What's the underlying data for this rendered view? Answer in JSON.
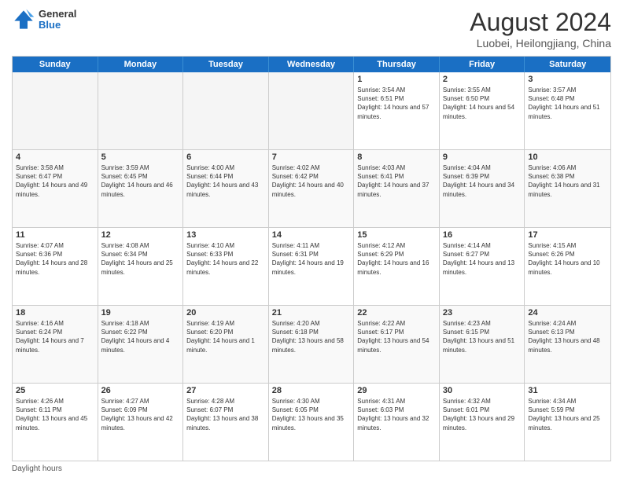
{
  "header": {
    "logo_general": "General",
    "logo_blue": "Blue",
    "main_title": "August 2024",
    "subtitle": "Luobei, Heilongjiang, China"
  },
  "footer": {
    "daylight_label": "Daylight hours"
  },
  "weekdays": [
    "Sunday",
    "Monday",
    "Tuesday",
    "Wednesday",
    "Thursday",
    "Friday",
    "Saturday"
  ],
  "weeks": [
    {
      "cells": [
        {
          "day": "",
          "info": "",
          "empty": true
        },
        {
          "day": "",
          "info": "",
          "empty": true
        },
        {
          "day": "",
          "info": "",
          "empty": true
        },
        {
          "day": "",
          "info": "",
          "empty": true
        },
        {
          "day": "1",
          "info": "Sunrise: 3:54 AM\nSunset: 6:51 PM\nDaylight: 14 hours and 57 minutes."
        },
        {
          "day": "2",
          "info": "Sunrise: 3:55 AM\nSunset: 6:50 PM\nDaylight: 14 hours and 54 minutes."
        },
        {
          "day": "3",
          "info": "Sunrise: 3:57 AM\nSunset: 6:48 PM\nDaylight: 14 hours and 51 minutes."
        }
      ]
    },
    {
      "cells": [
        {
          "day": "4",
          "info": "Sunrise: 3:58 AM\nSunset: 6:47 PM\nDaylight: 14 hours and 49 minutes."
        },
        {
          "day": "5",
          "info": "Sunrise: 3:59 AM\nSunset: 6:45 PM\nDaylight: 14 hours and 46 minutes."
        },
        {
          "day": "6",
          "info": "Sunrise: 4:00 AM\nSunset: 6:44 PM\nDaylight: 14 hours and 43 minutes."
        },
        {
          "day": "7",
          "info": "Sunrise: 4:02 AM\nSunset: 6:42 PM\nDaylight: 14 hours and 40 minutes."
        },
        {
          "day": "8",
          "info": "Sunrise: 4:03 AM\nSunset: 6:41 PM\nDaylight: 14 hours and 37 minutes."
        },
        {
          "day": "9",
          "info": "Sunrise: 4:04 AM\nSunset: 6:39 PM\nDaylight: 14 hours and 34 minutes."
        },
        {
          "day": "10",
          "info": "Sunrise: 4:06 AM\nSunset: 6:38 PM\nDaylight: 14 hours and 31 minutes."
        }
      ]
    },
    {
      "cells": [
        {
          "day": "11",
          "info": "Sunrise: 4:07 AM\nSunset: 6:36 PM\nDaylight: 14 hours and 28 minutes."
        },
        {
          "day": "12",
          "info": "Sunrise: 4:08 AM\nSunset: 6:34 PM\nDaylight: 14 hours and 25 minutes."
        },
        {
          "day": "13",
          "info": "Sunrise: 4:10 AM\nSunset: 6:33 PM\nDaylight: 14 hours and 22 minutes."
        },
        {
          "day": "14",
          "info": "Sunrise: 4:11 AM\nSunset: 6:31 PM\nDaylight: 14 hours and 19 minutes."
        },
        {
          "day": "15",
          "info": "Sunrise: 4:12 AM\nSunset: 6:29 PM\nDaylight: 14 hours and 16 minutes."
        },
        {
          "day": "16",
          "info": "Sunrise: 4:14 AM\nSunset: 6:27 PM\nDaylight: 14 hours and 13 minutes."
        },
        {
          "day": "17",
          "info": "Sunrise: 4:15 AM\nSunset: 6:26 PM\nDaylight: 14 hours and 10 minutes."
        }
      ]
    },
    {
      "cells": [
        {
          "day": "18",
          "info": "Sunrise: 4:16 AM\nSunset: 6:24 PM\nDaylight: 14 hours and 7 minutes."
        },
        {
          "day": "19",
          "info": "Sunrise: 4:18 AM\nSunset: 6:22 PM\nDaylight: 14 hours and 4 minutes."
        },
        {
          "day": "20",
          "info": "Sunrise: 4:19 AM\nSunset: 6:20 PM\nDaylight: 14 hours and 1 minute."
        },
        {
          "day": "21",
          "info": "Sunrise: 4:20 AM\nSunset: 6:18 PM\nDaylight: 13 hours and 58 minutes."
        },
        {
          "day": "22",
          "info": "Sunrise: 4:22 AM\nSunset: 6:17 PM\nDaylight: 13 hours and 54 minutes."
        },
        {
          "day": "23",
          "info": "Sunrise: 4:23 AM\nSunset: 6:15 PM\nDaylight: 13 hours and 51 minutes."
        },
        {
          "day": "24",
          "info": "Sunrise: 4:24 AM\nSunset: 6:13 PM\nDaylight: 13 hours and 48 minutes."
        }
      ]
    },
    {
      "cells": [
        {
          "day": "25",
          "info": "Sunrise: 4:26 AM\nSunset: 6:11 PM\nDaylight: 13 hours and 45 minutes."
        },
        {
          "day": "26",
          "info": "Sunrise: 4:27 AM\nSunset: 6:09 PM\nDaylight: 13 hours and 42 minutes."
        },
        {
          "day": "27",
          "info": "Sunrise: 4:28 AM\nSunset: 6:07 PM\nDaylight: 13 hours and 38 minutes."
        },
        {
          "day": "28",
          "info": "Sunrise: 4:30 AM\nSunset: 6:05 PM\nDaylight: 13 hours and 35 minutes."
        },
        {
          "day": "29",
          "info": "Sunrise: 4:31 AM\nSunset: 6:03 PM\nDaylight: 13 hours and 32 minutes."
        },
        {
          "day": "30",
          "info": "Sunrise: 4:32 AM\nSunset: 6:01 PM\nDaylight: 13 hours and 29 minutes."
        },
        {
          "day": "31",
          "info": "Sunrise: 4:34 AM\nSunset: 5:59 PM\nDaylight: 13 hours and 25 minutes."
        }
      ]
    }
  ]
}
